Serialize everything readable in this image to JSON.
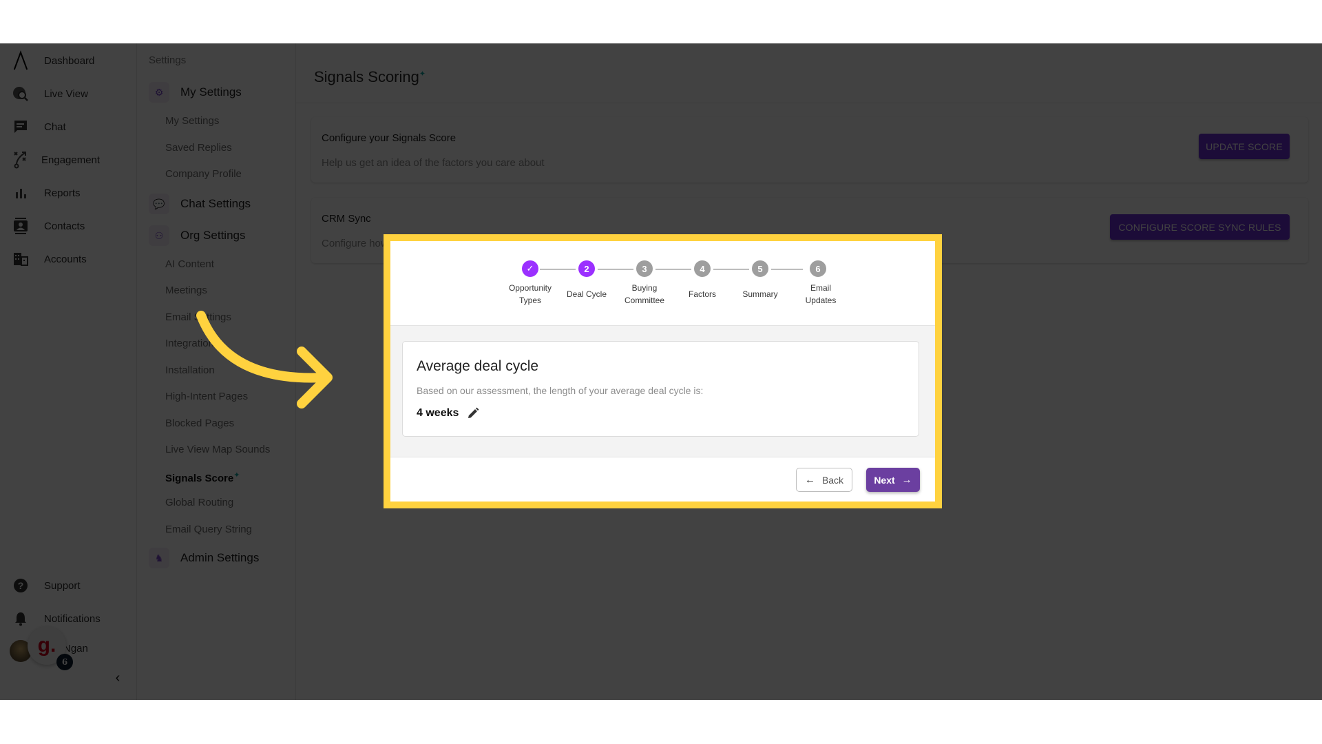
{
  "nav": {
    "items": [
      {
        "label": "Dashboard",
        "icon": "logo-icon"
      },
      {
        "label": "Live View",
        "icon": "globe-search-icon"
      },
      {
        "label": "Chat",
        "icon": "chat-icon"
      },
      {
        "label": "Engagement",
        "icon": "strategy-icon"
      },
      {
        "label": "Reports",
        "icon": "bar-chart-icon"
      },
      {
        "label": "Contacts",
        "icon": "contact-card-icon"
      },
      {
        "label": "Accounts",
        "icon": "building-icon"
      }
    ],
    "bottom_items": [
      {
        "label": "Support",
        "icon": "help-icon"
      },
      {
        "label": "Notifications",
        "icon": "bell-icon"
      }
    ],
    "user_name": "Ngan",
    "widget_letter": "g.",
    "widget_badge": "6",
    "collapse_glyph": "‹"
  },
  "settings": {
    "title": "Settings",
    "groups": [
      {
        "label": "My Settings",
        "icon": "gear-icon",
        "items": [
          "My Settings",
          "Saved Replies",
          "Company Profile"
        ]
      },
      {
        "label": "Chat Settings",
        "icon": "chat-bubbles-icon",
        "items": []
      },
      {
        "label": "Org Settings",
        "icon": "org-icon",
        "items": [
          "AI Content",
          "Meetings",
          "Email Settings",
          "Integrations",
          "Installation",
          "High-Intent Pages",
          "Blocked Pages",
          "Live View Map Sounds",
          "Signals Score",
          "Global Routing",
          "Email Query String"
        ]
      },
      {
        "label": "Admin Settings",
        "icon": "admin-icon",
        "items": []
      }
    ],
    "active_item": "Signals Score",
    "active_sup": "✦"
  },
  "main": {
    "title": "Signals Scoring",
    "title_sup": "✦",
    "cards": [
      {
        "title": "Configure your Signals Score",
        "desc": "Help us get an idea of the factors you care about",
        "button": "UPDATE SCORE"
      },
      {
        "title": "CRM Sync",
        "desc": "Configure how your Signals Score syncs to your CRM",
        "button": "CONFIGURE SCORE SYNC RULES"
      }
    ]
  },
  "modal": {
    "steps": [
      {
        "number": "1",
        "label": "Opportunity Types",
        "state": "done"
      },
      {
        "number": "2",
        "label": "Deal Cycle",
        "state": "current"
      },
      {
        "number": "3",
        "label": "Buying Committee",
        "state": "todo"
      },
      {
        "number": "4",
        "label": "Factors",
        "state": "todo"
      },
      {
        "number": "5",
        "label": "Summary",
        "state": "todo"
      },
      {
        "number": "6",
        "label": "Email Updates",
        "state": "todo"
      }
    ],
    "check_glyph": "✓",
    "heading": "Average deal cycle",
    "description": "Based on our assessment, the length of your average deal cycle is:",
    "value": "4 weeks",
    "back_label": "Back",
    "next_label": "Next",
    "back_arrow": "←",
    "next_arrow": "→"
  },
  "colors": {
    "accent_purple": "#9b30ff",
    "button_purple": "#6b3fa0",
    "highlight_yellow": "#ffd23f",
    "step_inactive": "#9e9e9e"
  }
}
